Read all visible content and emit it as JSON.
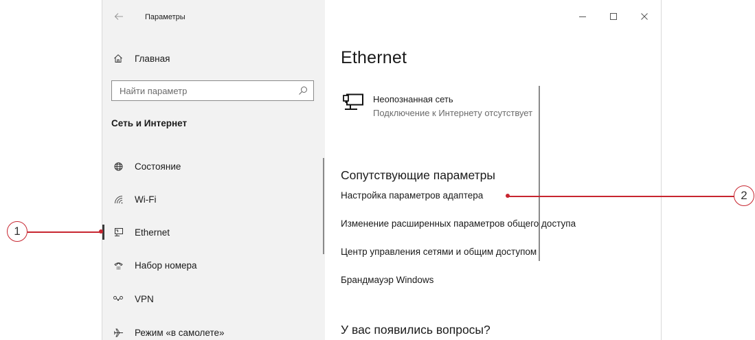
{
  "window": {
    "title": "Параметры",
    "controls": {
      "minimize": "—",
      "maximize": "☐",
      "close": "✕"
    }
  },
  "sidebar": {
    "home_label": "Главная",
    "search_placeholder": "Найти параметр",
    "section_heading": "Сеть и Интернет",
    "items": [
      {
        "label": "Состояние",
        "icon": "globe-icon"
      },
      {
        "label": "Wi-Fi",
        "icon": "wifi-icon"
      },
      {
        "label": "Ethernet",
        "icon": "ethernet-icon",
        "active": true
      },
      {
        "label": "Набор номера",
        "icon": "dialup-icon"
      },
      {
        "label": "VPN",
        "icon": "vpn-icon"
      },
      {
        "label": "Режим «в самолете»",
        "icon": "airplane-icon"
      }
    ]
  },
  "main": {
    "title": "Ethernet",
    "network": {
      "name": "Неопознанная сеть",
      "status": "Подключение к Интернету отсутствует",
      "icon": "network-monitor-icon"
    },
    "related_heading": "Сопутствующие параметры",
    "related_links": [
      "Настройка параметров адаптера",
      "Изменение расширенных параметров общего доступа",
      "Центр управления сетями и общим доступом",
      "Брандмауэр Windows"
    ],
    "faq_heading": "У вас появились вопросы?"
  },
  "callouts": [
    {
      "number": "1"
    },
    {
      "number": "2"
    }
  ],
  "colors": {
    "sidebar_bg": "#f2f2f2",
    "main_bg": "#ffffff",
    "callout_red": "#c7252f"
  }
}
